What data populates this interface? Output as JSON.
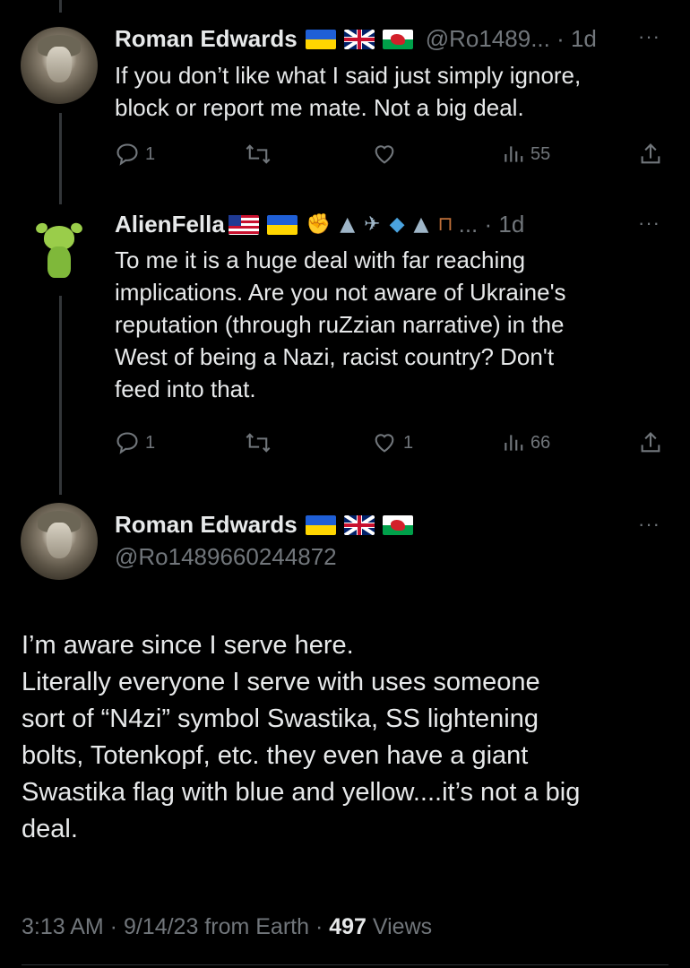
{
  "tweets": [
    {
      "name": "Roman Edwards",
      "handle_time": "@Ro1489... · 1d",
      "text": "If you don’t like what I said just simply ignore,\nblock or report me mate. Not a big deal.",
      "replies": "1",
      "retweets": "",
      "likes": "",
      "views": "55"
    },
    {
      "name": "AlienFella",
      "handle_time": "... · 1d",
      "text": "To me it is a huge deal with far reaching\nimplications. Are you not aware of Ukraine's\nreputation (through ruZzian narrative) in the\nWest of being a Nazi, racist country? Don't\nfeed into that.",
      "replies": "1",
      "retweets": "",
      "likes": "1",
      "views": "66"
    }
  ],
  "main_tweet": {
    "name": "Roman Edwards",
    "handle": "@Ro1489660244872",
    "text": "I’m aware since I serve here.\nLiterally everyone I serve with uses someone\nsort of “N4zi” symbol Swastika, SS lightening\nbolts, Totenkopf, etc. they even have a giant\nSwastika flag with blue and yellow....it’s not a big\ndeal.",
    "time": "3:13 AM · 9/14/23 from Earth · ",
    "views_count": "497",
    "views_label": " Views"
  },
  "more_label": "···",
  "icons": {
    "reply": "reply-icon",
    "retweet": "retweet-icon",
    "like": "heart-icon",
    "views": "views-icon",
    "share": "share-icon"
  }
}
